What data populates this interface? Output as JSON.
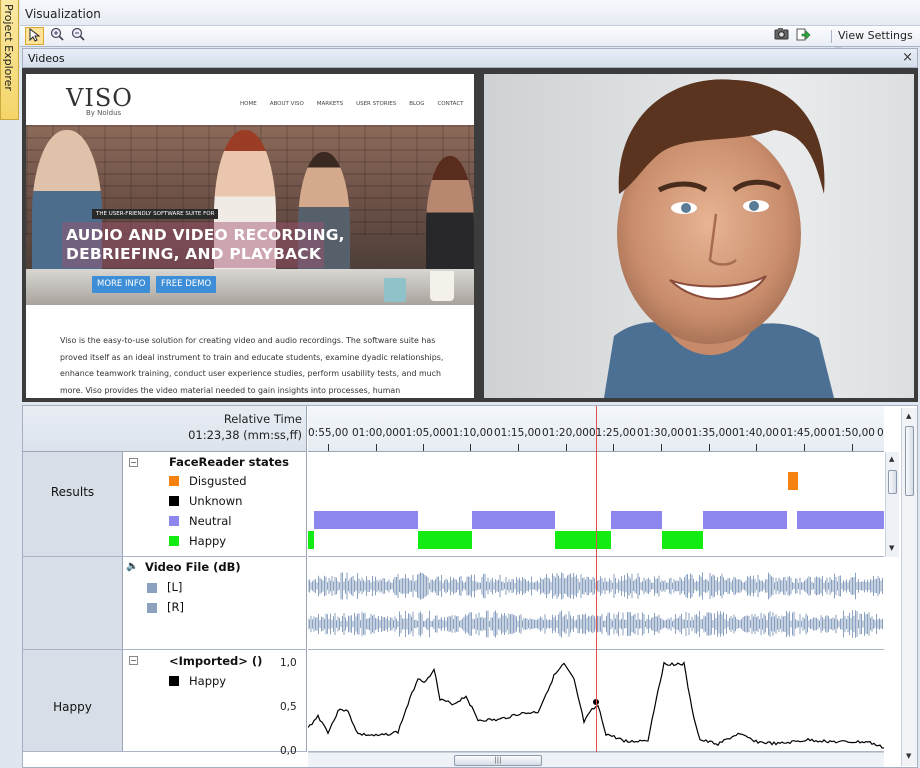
{
  "sidebar": {
    "tab_label": "Project Explorer"
  },
  "window": {
    "title": "Visualization"
  },
  "toolbar": {
    "pointer_icon": "arrow-pointer-icon",
    "zoom_in_icon": "zoom-in-icon",
    "zoom_out_icon": "zoom-out-icon",
    "camera_icon": "camera-icon",
    "export_icon": "export-icon",
    "view_settings_label": "View Settings"
  },
  "videos_panel": {
    "title": "Videos",
    "close_glyph": "×",
    "website": {
      "logo": "VISO",
      "logo_sub": "By Noldus",
      "nav": [
        "HOME",
        "ABOUT VISO",
        "MARKETS",
        "USER STORIES",
        "BLOG",
        "CONTACT"
      ],
      "hero_tag": "THE USER-FRIENDLY SOFTWARE SUITE FOR",
      "hero_line1": "AUDIO AND VIDEO RECORDING,",
      "hero_line2": "DEBRIEFING, AND PLAYBACK",
      "btn_more": "MORE INFO",
      "btn_demo": "FREE DEMO",
      "paragraph": "Viso is the easy-to-use solution for creating video and audio recordings. The software suite has proved itself as an ideal instrument to train and educate students, examine dyadic relationships, enhance teamwork training, conduct user experience studies, perform usability tests, and much more. Viso provides the video material needed to gain insights into processes, human performance, and communication. Moreover,"
    }
  },
  "timeline": {
    "relative_time_label": "Relative Time",
    "current_time": "01:23,38 (mm:ss,ff)",
    "ticks": [
      "0:55,00",
      "01:00,00",
      "01:05,00",
      "01:10,00",
      "01:15,00",
      "01:20,00",
      "01:25,00",
      "01:30,00",
      "01:35,00",
      "01:40,00",
      "01:45,00",
      "01:50,00",
      "0"
    ],
    "rows": {
      "results": {
        "label": "Results",
        "group_title": "FaceReader states",
        "states": [
          {
            "name": "Disgusted",
            "color": "#f5820f"
          },
          {
            "name": "Unknown",
            "color": "#000000"
          },
          {
            "name": "Neutral",
            "color": "#8c86ee"
          },
          {
            "name": "Happy",
            "color": "#13ec13"
          }
        ]
      },
      "video": {
        "title": "Video File (dB)",
        "speaker_icon": "speaker-icon",
        "channels": [
          {
            "name": "[L]",
            "color": "#8aa2c0"
          },
          {
            "name": "[R]",
            "color": "#8aa2c0"
          }
        ]
      },
      "happy": {
        "label": "Happy",
        "group_title": "<Imported> ()",
        "series_name": "Happy",
        "y_labels": [
          "1,0",
          "0,5",
          "0,0"
        ]
      }
    },
    "scroll_glyph": "|||"
  }
}
